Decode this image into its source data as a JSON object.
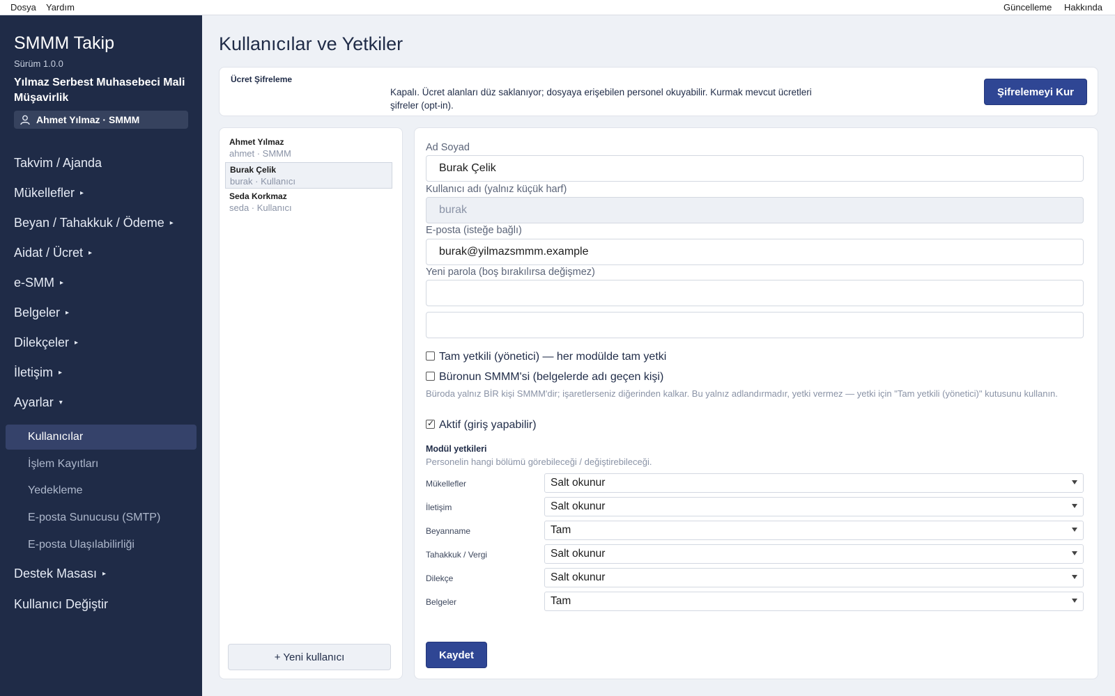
{
  "menubar": {
    "left": [
      "Dosya",
      "Yardım"
    ],
    "right": [
      "Güncelleme",
      "Hakkında"
    ]
  },
  "sidebar": {
    "app_title": "SMMM Takip",
    "version": "Sürüm 1.0.0",
    "firm": "Yılmaz Serbest Muhasebeci Mali Müşavirlik",
    "user": "Ahmet Yılmaz · SMMM",
    "nav": [
      {
        "label": "Takvim / Ajanda",
        "arrow": ""
      },
      {
        "label": "Mükellefler",
        "arrow": "▸"
      },
      {
        "label": "Beyan / Tahakkuk / Ödeme",
        "arrow": "▸"
      },
      {
        "label": "Aidat / Ücret",
        "arrow": "▸"
      },
      {
        "label": "e-SMM",
        "arrow": "▸"
      },
      {
        "label": "Belgeler",
        "arrow": "▸"
      },
      {
        "label": "Dilekçeler",
        "arrow": "▸"
      },
      {
        "label": "İletişim",
        "arrow": "▸"
      },
      {
        "label": "Ayarlar",
        "arrow": "▾"
      }
    ],
    "sub": [
      "Kullanıcılar",
      "İşlem Kayıtları",
      "Yedekleme",
      "E-posta Sunucusu (SMTP)",
      "E-posta Ulaşılabilirliği"
    ],
    "nav_bottom": [
      {
        "label": "Destek Masası",
        "arrow": "▸"
      },
      {
        "label": "Kullanıcı Değiştir",
        "arrow": ""
      }
    ]
  },
  "page": {
    "title": "Kullanıcılar ve Yetkiler"
  },
  "encryption": {
    "label": "Ücret Şifreleme",
    "description": "Kapalı. Ücret alanları düz saklanıyor; dosyaya erişebilen personel okuyabilir. Kurmak mevcut ücretleri şifreler (opt-in).",
    "button": "Şifrelemeyi Kur"
  },
  "users": [
    {
      "name": "Ahmet Yılmaz",
      "sub": "ahmet · SMMM"
    },
    {
      "name": "Burak Çelik",
      "sub": "burak · Kullanıcı"
    },
    {
      "name": "Seda Korkmaz",
      "sub": "seda · Kullanıcı"
    }
  ],
  "new_user_button": "+ Yeni kullanıcı",
  "form": {
    "name_label": "Ad Soyad",
    "name_value": "Burak Çelik",
    "username_label": "Kullanıcı adı (yalnız küçük harf)",
    "username_value": "burak",
    "email_label": "E-posta (isteğe bağlı)",
    "email_value": "burak@yilmazsmmm.example",
    "password_label": "Yeni parola (boş bırakılırsa değişmez)",
    "password_value": "",
    "password_confirm_value": "",
    "admin_label": "Tam yetkili (yönetici) — her modülde tam yetki",
    "admin_checked": false,
    "smmm_label": "Büronun SMMM'si (belgelerde adı geçen kişi)",
    "smmm_checked": false,
    "smmm_hint": "Büroda yalnız BİR kişi SMMM'dir; işaretlerseniz diğerinden kalkar. Bu yalnız adlandırmadır, yetki vermez — yetki için \"Tam yetkili (yönetici)\" kutusunu kullanın.",
    "active_label": "Aktif (giriş yapabilir)",
    "active_checked": true,
    "perm_title": "Modül yetkileri",
    "perm_hint": "Personelin hangi bölümü görebileceği / değiştirebileceği.",
    "permissions": [
      {
        "module": "Mükellefler",
        "value": "Salt okunur"
      },
      {
        "module": "İletişim",
        "value": "Salt okunur"
      },
      {
        "module": "Beyanname",
        "value": "Tam"
      },
      {
        "module": "Tahakkuk / Vergi",
        "value": "Salt okunur"
      },
      {
        "module": "Dilekçe",
        "value": "Salt okunur"
      },
      {
        "module": "Belgeler",
        "value": "Tam"
      }
    ],
    "save_button": "Kaydet"
  }
}
